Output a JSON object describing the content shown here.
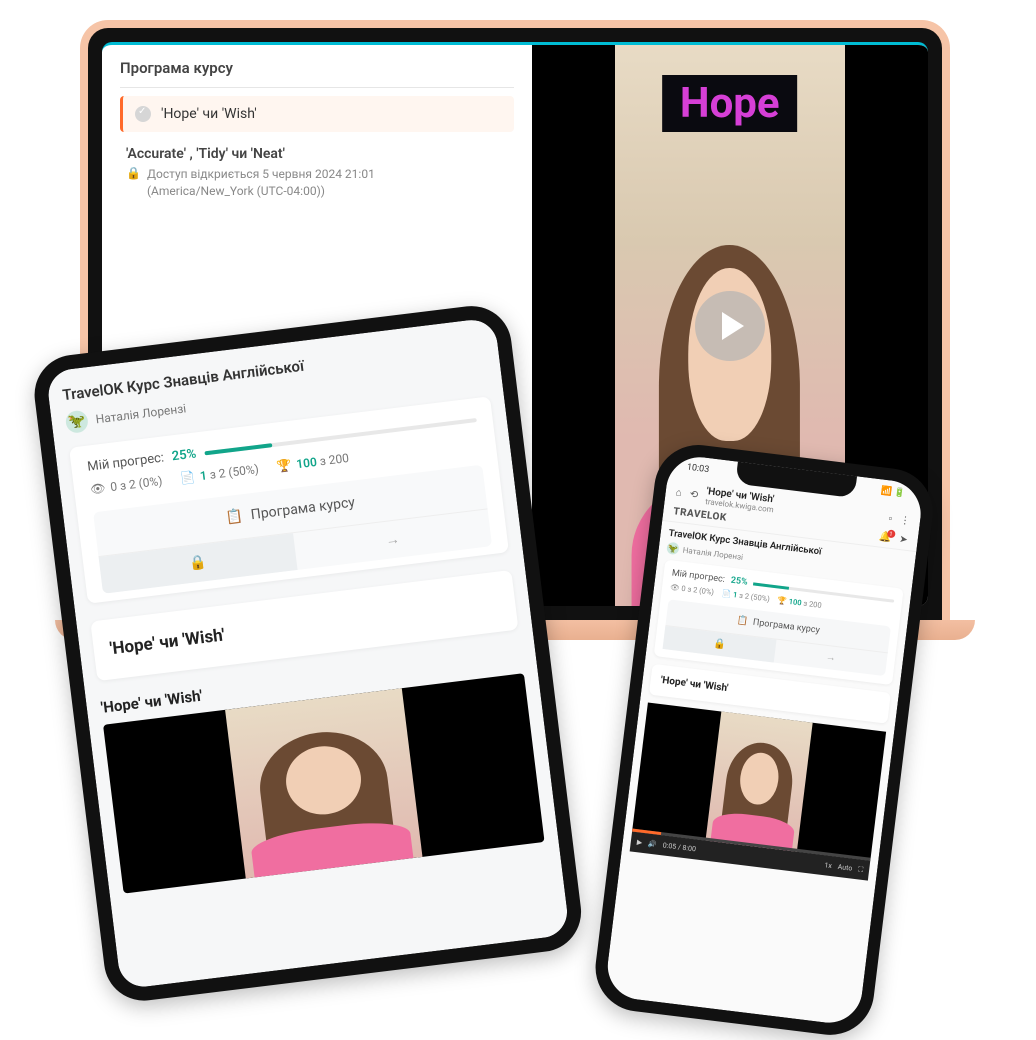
{
  "laptop": {
    "program_title": "Програма курсу",
    "active_lesson": "'Hope' чи 'Wish'",
    "locked_lesson": {
      "title": "'Accurate' , 'Tidy' чи 'Neat'",
      "sub1": "Доступ відкриється  5 червня 2024 21:01",
      "sub2": "(America/New_York (UTC-04:00))"
    },
    "video_overlay": "Hope"
  },
  "tablet": {
    "course_title": "TravelOK Курс Знавців Англійської",
    "author": "Наталія Лорензі",
    "progress_label": "Мій прогрес:",
    "progress_pct": "25%",
    "stats": {
      "views": "0 з 2 (0%)",
      "docs": "1 з 2 (50%)",
      "trophy": "100 з 200"
    },
    "program_title": "Програма курсу",
    "lesson_title": "'Hope' чи 'Wish'",
    "video_caption": "'Hope' чи 'Wish'"
  },
  "phone": {
    "status_time": "10:03",
    "nav_title": "'Hope' чи 'Wish'",
    "nav_url": "travelok.kwiga.com",
    "brand": "TRAVELOK",
    "bell_badge": "1",
    "course_title": "TravelOK Курс Знавців Англійської",
    "author": "Наталія Лорензі",
    "progress_label": "Мій прогрес:",
    "progress_pct": "25%",
    "stats": {
      "views": "0 з 2 (0%)",
      "docs": "1 з 2 (50%)",
      "trophy": "100 з 200"
    },
    "program_title": "Програма курсу",
    "lesson_title": "'Hope' чи 'Wish'",
    "player": {
      "time": "0:05 / 8:00",
      "speed": "1x",
      "auto": "Auto"
    }
  }
}
